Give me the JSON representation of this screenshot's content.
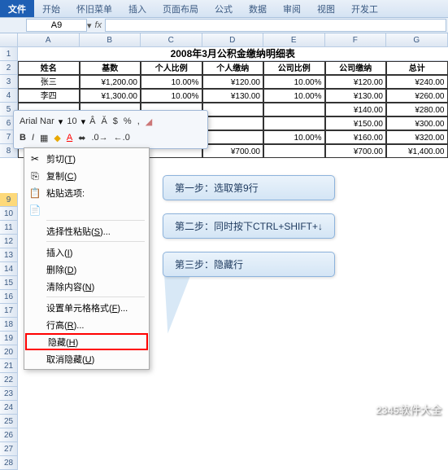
{
  "ribbon": {
    "tabs": [
      "文件",
      "开始",
      "怀旧菜单",
      "插入",
      "页面布局",
      "公式",
      "数据",
      "审阅",
      "视图",
      "开发工"
    ]
  },
  "namebox": {
    "value": "A9",
    "fx": "fx"
  },
  "columns": [
    "A",
    "B",
    "C",
    "D",
    "E",
    "F",
    "G"
  ],
  "title": "2008年3月公积金缴纳明细表",
  "headers": [
    "姓名",
    "基数",
    "个人比例",
    "个人缴纳",
    "公司比例",
    "公司缴纳",
    "总计"
  ],
  "data": [
    [
      "张三",
      "¥1,200.00",
      "10.00%",
      "¥120.00",
      "10.00%",
      "¥120.00",
      "¥240.00"
    ],
    [
      "李四",
      "¥1,300.00",
      "10.00%",
      "¥130.00",
      "10.00%",
      "¥130.00",
      "¥260.00"
    ],
    [
      "",
      "",
      "",
      "",
      "",
      "¥140.00",
      "¥280.00"
    ],
    [
      "",
      "",
      "",
      "",
      "",
      "¥150.00",
      "¥300.00"
    ],
    [
      "",
      "",
      "",
      "",
      "10.00%",
      "¥160.00",
      "¥320.00"
    ],
    [
      "",
      "",
      "",
      "¥700.00",
      "",
      "¥700.00",
      "¥1,400.00"
    ]
  ],
  "row_labels_visible": [
    "1",
    "2",
    "3",
    "4",
    "5",
    "6",
    "7",
    "8"
  ],
  "row_labels_empty": [
    "9",
    "10",
    "11",
    "12",
    "13",
    "14",
    "15",
    "16",
    "17",
    "18",
    "19",
    "20",
    "21",
    "22",
    "23",
    "24",
    "25",
    "26",
    "27",
    "28"
  ],
  "mini_toolbar": {
    "font": "Arial Nar",
    "size": "10"
  },
  "context_menu": [
    {
      "icon": "✂",
      "label": "剪切",
      "key": "T"
    },
    {
      "icon": "⎘",
      "label": "复制",
      "key": "C"
    },
    {
      "icon": "📋",
      "label": "粘贴选项:",
      "key": ""
    },
    {
      "icon": "",
      "label": "选择性粘贴",
      "key": "S",
      "suffix": "..."
    },
    {
      "icon": "",
      "label": "插入",
      "key": "I"
    },
    {
      "icon": "",
      "label": "删除",
      "key": "D"
    },
    {
      "icon": "",
      "label": "清除内容",
      "key": "N"
    },
    {
      "icon": "",
      "label": "设置单元格格式",
      "key": "F",
      "suffix": "..."
    },
    {
      "icon": "",
      "label": "行高",
      "key": "R",
      "suffix": "..."
    },
    {
      "icon": "",
      "label": "隐藏",
      "key": "H",
      "highlight": true
    },
    {
      "icon": "",
      "label": "取消隐藏",
      "key": "U"
    }
  ],
  "callouts": [
    "第一步：选取第9行",
    "第二步：同时按下CTRL+SHIFT+↓",
    "第三步：隐藏行"
  ],
  "watermark": "2345软件大全"
}
